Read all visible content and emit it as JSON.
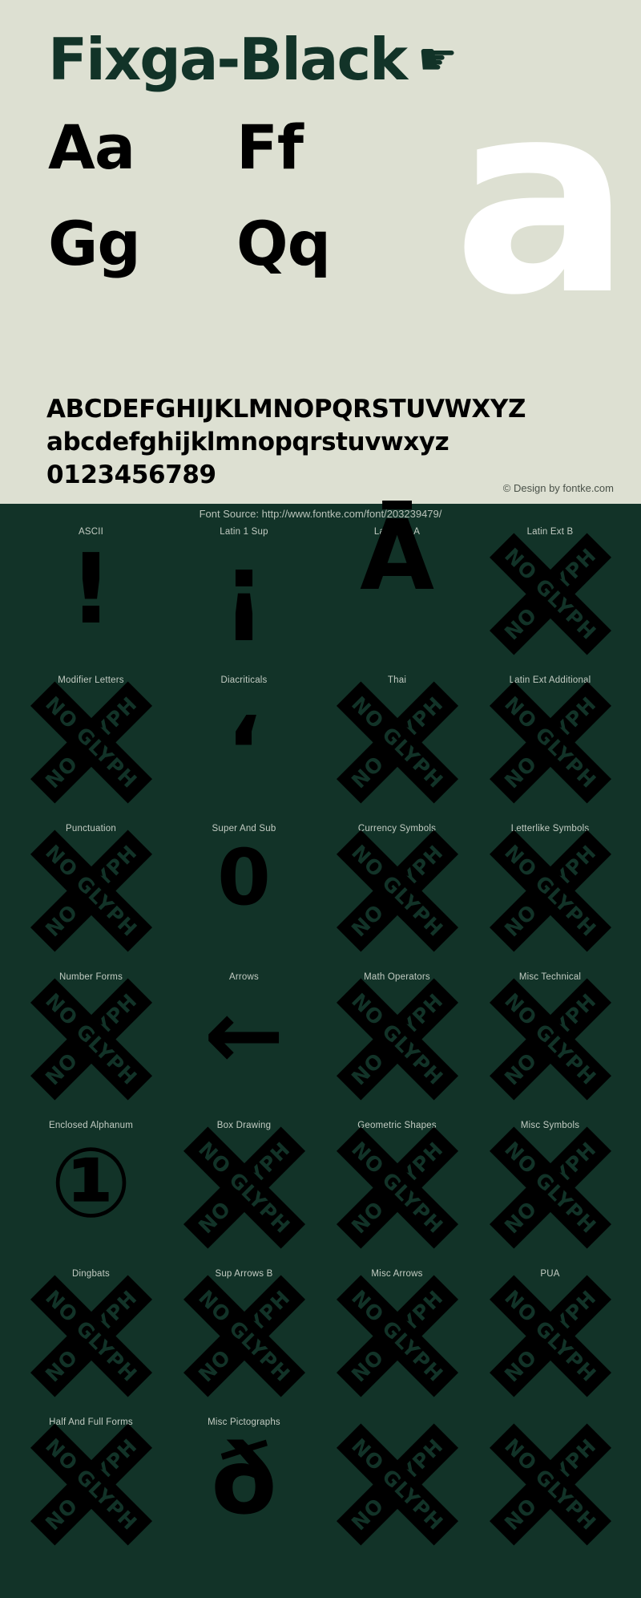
{
  "colors": {
    "panel_bg": "#dde0d2",
    "dark_bg": "#123328",
    "title": "#123328",
    "glyph": "#000000",
    "watermark": "#ffffff",
    "label": "#c3ccc3"
  },
  "header": {
    "font_name": "Fixga-Black",
    "pointer_icon": "☛"
  },
  "samples": {
    "watermark_letter": "a",
    "pairs": [
      [
        "Aa",
        "Ff"
      ],
      [
        "Gg",
        "Qq"
      ]
    ],
    "alphabet_upper": "ABCDEFGHIJKLMNOPQRSTUVWXYZ",
    "alphabet_lower": "abcdefghijklmnopqrstuvwxyz",
    "digits": "0123456789"
  },
  "credits": {
    "design": "© Design by fontke.com",
    "source": "Font Source: http://www.fontke.com/font/203239479/"
  },
  "noglyph_label": "NO GLYPH",
  "glyph_blocks": [
    {
      "label": "ASCII",
      "glyph": "!",
      "kind": "char"
    },
    {
      "label": "Latin 1 Sup",
      "glyph": "¡",
      "kind": "char"
    },
    {
      "label": "Latin Ext A",
      "glyph": "Ā",
      "kind": "char"
    },
    {
      "label": "Latin Ext B",
      "glyph": "",
      "kind": "noglyph"
    },
    {
      "label": "Modifier Letters",
      "glyph": "",
      "kind": "noglyph"
    },
    {
      "label": "Diacriticals",
      "glyph": "ʻ",
      "kind": "comma"
    },
    {
      "label": "Thai",
      "glyph": "",
      "kind": "noglyph"
    },
    {
      "label": "Latin Ext Additional",
      "glyph": "",
      "kind": "noglyph"
    },
    {
      "label": "Punctuation",
      "glyph": "",
      "kind": "noglyph"
    },
    {
      "label": "Super And Sub",
      "glyph": "0",
      "kind": "small"
    },
    {
      "label": "Currency Symbols",
      "glyph": "",
      "kind": "noglyph"
    },
    {
      "label": "Letterlike Symbols",
      "glyph": "",
      "kind": "noglyph"
    },
    {
      "label": "Number Forms",
      "glyph": "",
      "kind": "noglyph"
    },
    {
      "label": "Arrows",
      "glyph": "←",
      "kind": "char"
    },
    {
      "label": "Math Operators",
      "glyph": "",
      "kind": "noglyph"
    },
    {
      "label": "Misc Technical",
      "glyph": "",
      "kind": "noglyph"
    },
    {
      "label": "Enclosed Alphanum",
      "glyph": "①",
      "kind": "char"
    },
    {
      "label": "Box Drawing",
      "glyph": "",
      "kind": "noglyph"
    },
    {
      "label": "Geometric Shapes",
      "glyph": "",
      "kind": "noglyph"
    },
    {
      "label": "Misc Symbols",
      "glyph": "",
      "kind": "noglyph"
    },
    {
      "label": "Dingbats",
      "glyph": "",
      "kind": "noglyph"
    },
    {
      "label": "Sup Arrows B",
      "glyph": "",
      "kind": "noglyph"
    },
    {
      "label": "Misc Arrows",
      "glyph": "",
      "kind": "noglyph"
    },
    {
      "label": "PUA",
      "glyph": "",
      "kind": "noglyph"
    },
    {
      "label": "Half And Full Forms",
      "glyph": "",
      "kind": "noglyph"
    },
    {
      "label": "Misc Pictographs",
      "glyph": "ð",
      "kind": "char"
    },
    {
      "label": "",
      "glyph": "",
      "kind": "noglyph"
    },
    {
      "label": "",
      "glyph": "",
      "kind": "noglyph"
    }
  ]
}
